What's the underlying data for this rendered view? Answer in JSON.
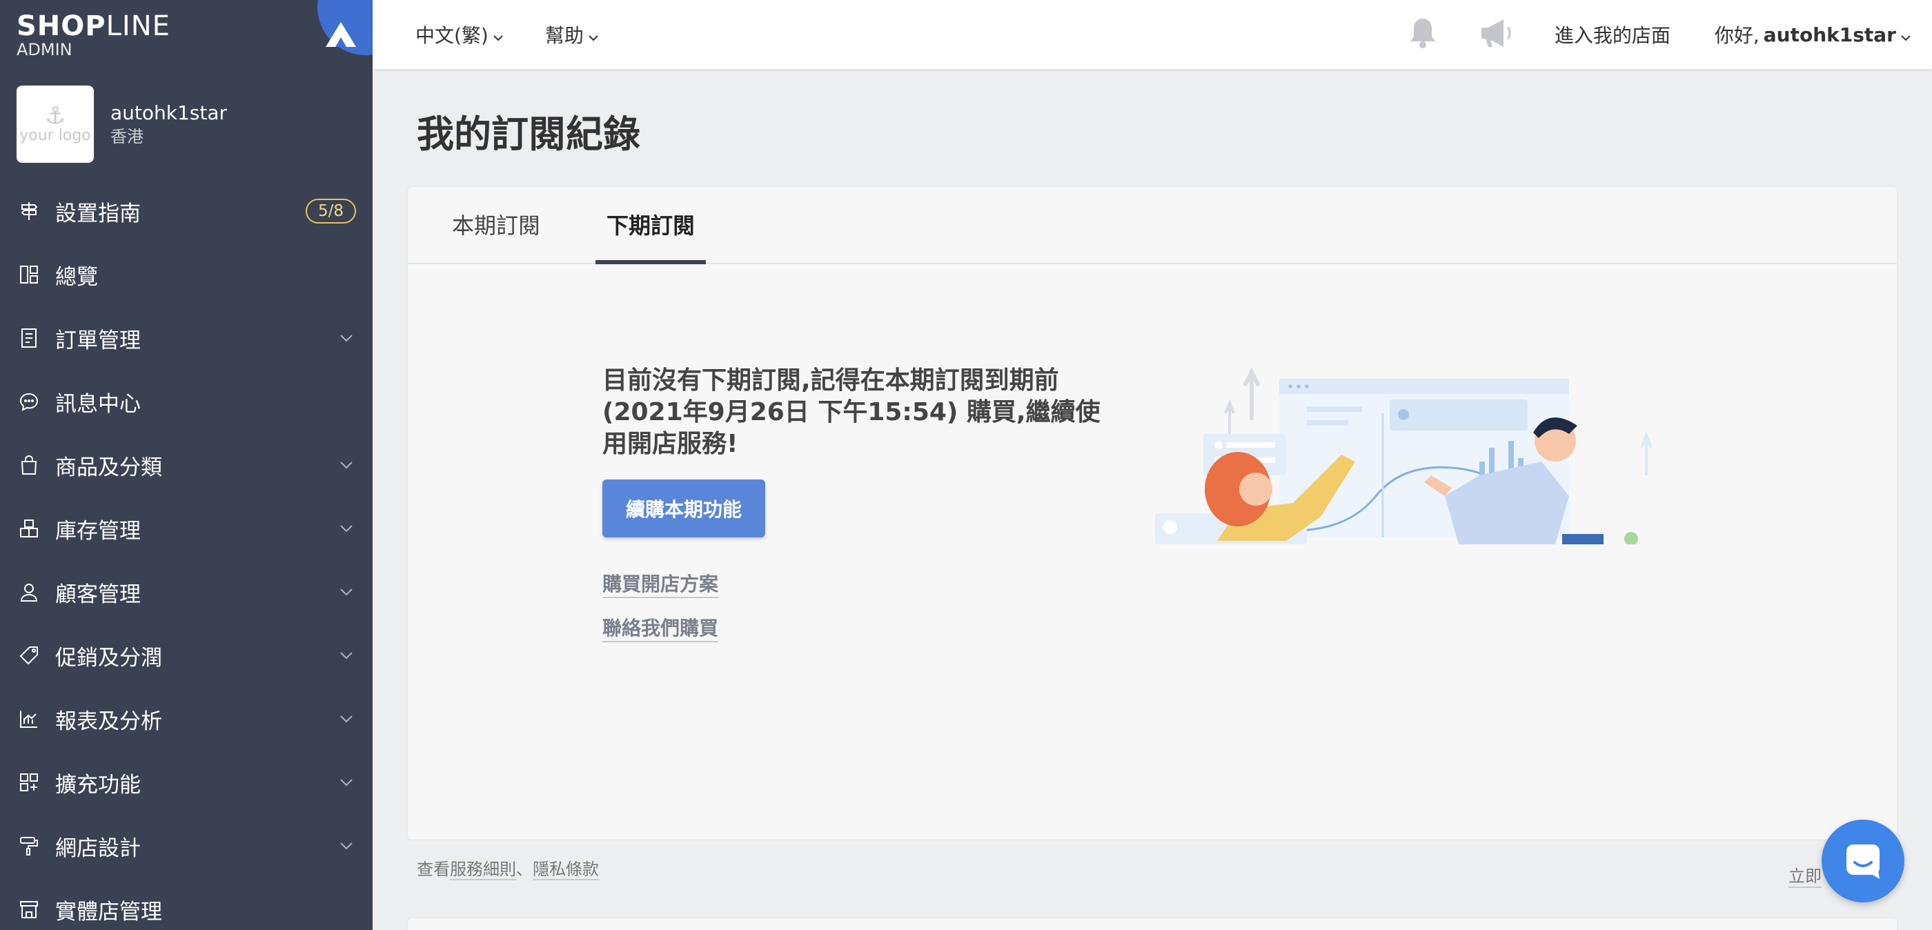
{
  "brand": {
    "name_bold": "SHOP",
    "name_thin": "LINE",
    "sub": "ADMIN"
  },
  "store": {
    "name": "autohk1star",
    "region": "香港",
    "logo_text": "your logo"
  },
  "sidebar": {
    "items": [
      {
        "label": "設置指南",
        "icon": "signpost-icon",
        "badge": "5/8"
      },
      {
        "label": "總覽",
        "icon": "dashboard-icon"
      },
      {
        "label": "訂單管理",
        "icon": "order-icon",
        "expandable": true
      },
      {
        "label": "訊息中心",
        "icon": "chat-bubble-icon"
      },
      {
        "label": "商品及分類",
        "icon": "shopping-bag-icon",
        "expandable": true
      },
      {
        "label": "庫存管理",
        "icon": "inventory-icon",
        "expandable": true
      },
      {
        "label": "顧客管理",
        "icon": "user-icon",
        "expandable": true
      },
      {
        "label": "促銷及分潤",
        "icon": "tag-icon",
        "expandable": true
      },
      {
        "label": "報表及分析",
        "icon": "chart-icon",
        "expandable": true
      },
      {
        "label": "擴充功能",
        "icon": "apps-plus-icon",
        "expandable": true
      },
      {
        "label": "網店設計",
        "icon": "paint-roller-icon",
        "expandable": true
      },
      {
        "label": "實體店管理",
        "icon": "store-icon"
      }
    ]
  },
  "topbar": {
    "language": "中文(繁)",
    "help": "幫助",
    "enter_store": "進入我的店面",
    "greeting": "你好,",
    "username": "autohk1star"
  },
  "page": {
    "title": "我的訂閱紀錄",
    "tabs": [
      {
        "label": "本期訂閱",
        "active": false
      },
      {
        "label": "下期訂閱",
        "active": true
      }
    ],
    "empty_message": "目前沒有下期訂閱,記得在本期訂閱到期前 (2021年9月26日 下午15:54) 購買,繼續使用開店服務!",
    "renew_button": "續購本期功能",
    "link_buy_plan": "購買開店方案",
    "link_contact": "聯絡我們購買"
  },
  "footer": {
    "prefix": "查看",
    "terms": "服務細則",
    "sep": "、",
    "privacy": "隱私條款",
    "right_link": "立即"
  },
  "colors": {
    "sidebar_bg": "#3a4152",
    "accent": "#5a86d9",
    "badge": "#e8c25a",
    "chat": "#3f86e8"
  }
}
